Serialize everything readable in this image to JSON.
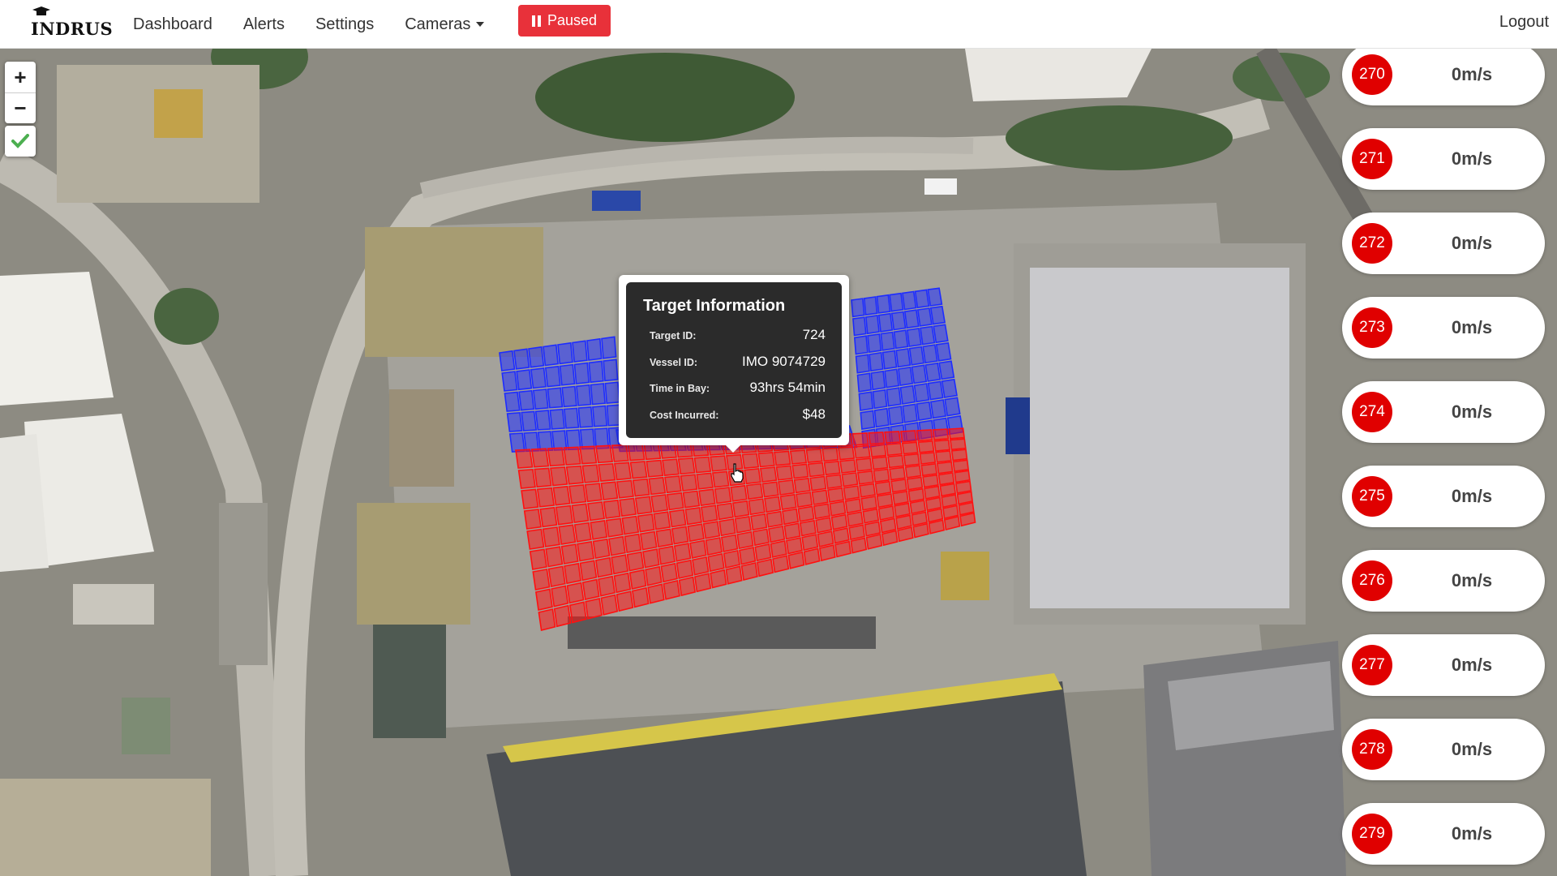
{
  "brand": {
    "name": "INDRUS"
  },
  "nav": {
    "dashboard": "Dashboard",
    "alerts": "Alerts",
    "settings": "Settings",
    "cameras": "Cameras",
    "paused": "Paused",
    "logout": "Logout"
  },
  "map_controls": {
    "zoom_in": "+",
    "zoom_out": "−",
    "confirm_icon": "check-icon"
  },
  "popup": {
    "title": "Target Information",
    "rows": [
      {
        "label": "Target ID:",
        "value": "724"
      },
      {
        "label": "Vessel ID:",
        "value": "IMO 9074729"
      },
      {
        "label": "Time in Bay:",
        "value": "93hrs 54min"
      },
      {
        "label": "Cost Incurred:",
        "value": "$48"
      }
    ]
  },
  "targets": [
    {
      "id": "270",
      "speed": "0m/s"
    },
    {
      "id": "271",
      "speed": "0m/s"
    },
    {
      "id": "272",
      "speed": "0m/s"
    },
    {
      "id": "273",
      "speed": "0m/s"
    },
    {
      "id": "274",
      "speed": "0m/s"
    },
    {
      "id": "275",
      "speed": "0m/s"
    },
    {
      "id": "276",
      "speed": "0m/s"
    },
    {
      "id": "277",
      "speed": "0m/s"
    },
    {
      "id": "278",
      "speed": "0m/s"
    },
    {
      "id": "279",
      "speed": "0m/s"
    }
  ],
  "colors": {
    "accent_red": "#e8313a",
    "badge_red": "#e00000",
    "bay_blue": "#1d2cff",
    "bay_red": "#ff1010"
  }
}
